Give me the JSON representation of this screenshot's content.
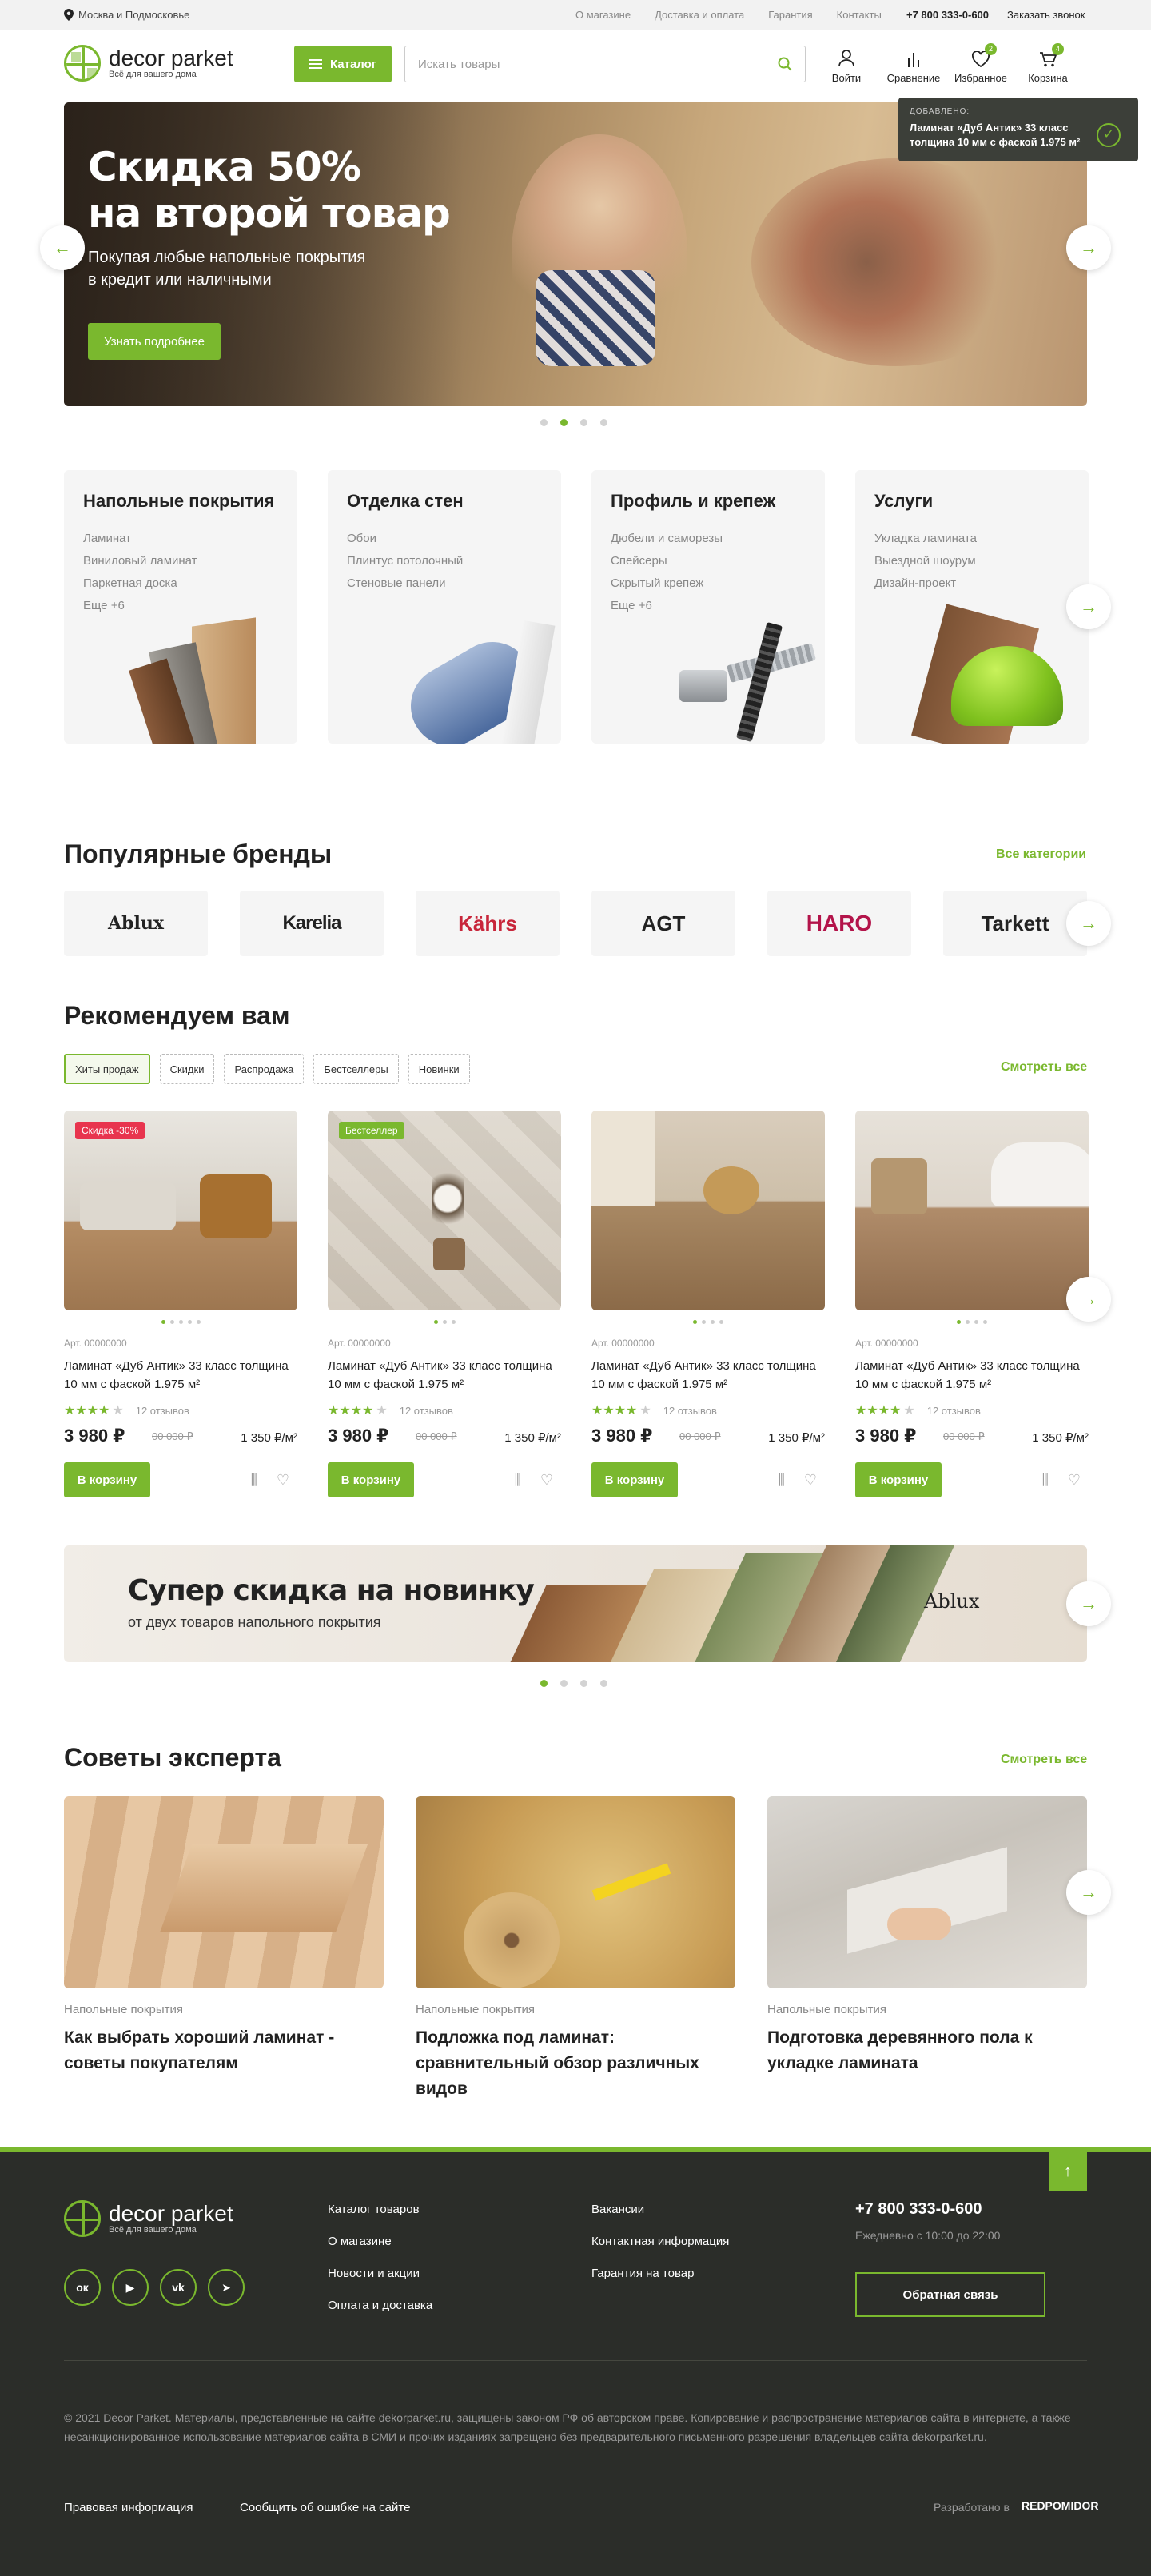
{
  "topbar": {
    "region": "Москва и Подмосковье",
    "links": [
      "О магазине",
      "Доставка и оплата",
      "Гарантия",
      "Контакты"
    ],
    "phone": "+7 800 333-0-600",
    "callback": "Заказать звонок"
  },
  "header": {
    "logo_name": "decor parket",
    "logo_sub": "Всё для вашего дома",
    "catalog": "Каталог",
    "search_placeholder": "Искать товары",
    "icons": [
      {
        "label": "Войти",
        "icon": "user-icon"
      },
      {
        "label": "Сравнение",
        "icon": "compare-icon"
      },
      {
        "label": "Избранное",
        "icon": "heart-icon",
        "badge": "2"
      },
      {
        "label": "Корзина",
        "icon": "cart-icon",
        "badge": "4"
      }
    ]
  },
  "toast": {
    "heading": "ДОБАВЛЕНО:",
    "text": "Ламинат «Дуб Антик» 33 класс толщина 10 мм с фаской 1.975 м²"
  },
  "hero": {
    "title_line1": "Скидка 50%",
    "title_line2": "на второй товар",
    "subtitle_line1": "Покупая любые напольные покрытия",
    "subtitle_line2": "в кредит или наличными",
    "button": "Узнать подробнее",
    "active_slide": 2,
    "slides": 4
  },
  "categories": [
    {
      "title": "Напольные покрытия",
      "items": [
        "Ламинат",
        "Виниловый ламинат",
        "Паркетная доска",
        "Еще +6"
      ]
    },
    {
      "title": "Отделка стен",
      "items": [
        "Обои",
        "Плинтус потолочный",
        "Стеновые панели"
      ]
    },
    {
      "title": "Профиль и крепеж",
      "items": [
        "Дюбели и саморезы",
        "Спейсеры",
        "Скрытый крепеж",
        "Еще +6"
      ]
    },
    {
      "title": "Услуги",
      "items": [
        "Укладка ламината",
        "Выездной шоурум",
        "Дизайн-проект"
      ]
    }
  ],
  "brands": {
    "title": "Популярные бренды",
    "all_link": "Все категории",
    "items": [
      {
        "name": "Ablux",
        "color": "#222222"
      },
      {
        "name": "Karelia",
        "color": "#111111"
      },
      {
        "name": "Kährs",
        "color": "#c8263b"
      },
      {
        "name": "AGT",
        "color": "#111111"
      },
      {
        "name": "HARO",
        "color": "#b3144a"
      },
      {
        "name": "Tarkett",
        "color": "#111111"
      }
    ]
  },
  "recommend": {
    "title": "Рекомендуем вам",
    "see_all": "Смотреть все",
    "filters": [
      "Хиты продаж",
      "Скидки",
      "Распродажа",
      "Бестселлеры",
      "Новинки"
    ],
    "products": [
      {
        "label": "Скидка -30%",
        "label_color": "#e8344e",
        "art": "Арт. 00000000",
        "name": "Ламинат «Дуб Антик» 33 класс толщина 10 мм с фаской 1.975 м²",
        "rating": 4,
        "reviews": "12 отзывов",
        "price": "3 980 ₽",
        "old_price": "00 000 ₽",
        "per_m2": "1 350 ₽/м²",
        "cart": "В корзину"
      },
      {
        "label": "Бестселлер",
        "label_color": "#7ab82e",
        "art": "Арт. 00000000",
        "name": "Ламинат «Дуб Антик» 33 класс толщина 10 мм с фаской 1.975 м²",
        "rating": 4,
        "reviews": "12 отзывов",
        "price": "3 980 ₽",
        "old_price": "00 000 ₽",
        "per_m2": "1 350 ₽/м²",
        "cart": "В корзину"
      },
      {
        "label": "",
        "label_color": "",
        "art": "Арт. 00000000",
        "name": "Ламинат «Дуб Антик» 33 класс толщина 10 мм с фаской 1.975 м²",
        "rating": 4,
        "reviews": "12 отзывов",
        "price": "3 980 ₽",
        "old_price": "00 000 ₽",
        "per_m2": "1 350 ₽/м²",
        "cart": "В корзину"
      },
      {
        "label": "",
        "label_color": "",
        "art": "Арт. 00000000",
        "name": "Ламинат «Дуб Антик» 33 класс толщина 10 мм с фаской 1.975 м²",
        "rating": 4,
        "reviews": "12 отзывов",
        "price": "3 980 ₽",
        "old_price": "00 000 ₽",
        "per_m2": "1 350 ₽/м²",
        "cart": "В корзину"
      }
    ]
  },
  "promo": {
    "title": "Супер скидка на новинку",
    "subtitle": "от двух товаров напольного покрытия",
    "brand": "Ablux"
  },
  "expert": {
    "title": "Советы эксперта",
    "see_all": "Смотреть все",
    "articles": [
      {
        "category": "Напольные покрытия",
        "title": "Как выбрать хороший ламинат - советы покупателям"
      },
      {
        "category": "Напольные покрытия",
        "title": "Подложка под ламинат: сравнительный обзор различных видов"
      },
      {
        "category": "Напольные покрытия",
        "title": "Подготовка деревянного пола к укладке ламината"
      }
    ]
  },
  "footer": {
    "logo_name": "decor parket",
    "logo_sub": "Всё для вашего дома",
    "col1": [
      "Каталог товаров",
      "О магазине",
      "Новости и акции",
      "Оплата и доставка"
    ],
    "col2": [
      "Вакансии",
      "Контактная информация",
      "Гарантия на товар"
    ],
    "phone": "+7 800 333-0-600",
    "hours": "Ежедневно с 10:00 до 22:00",
    "feedback": "Обратная связь",
    "social": [
      {
        "name": "odnoklassniki",
        "glyph": "ок"
      },
      {
        "name": "youtube",
        "glyph": "▶"
      },
      {
        "name": "vk",
        "glyph": "vk"
      },
      {
        "name": "telegram",
        "glyph": "➤"
      }
    ],
    "copyright": "© 2021 Decor Parket. Материалы, представленные на сайте dekorparket.ru, защищены законом РФ об авторском праве. Копирование и распространение материалов сайта в интернете, а также несанкционированное использование материалов сайта в СМИ и прочих изданиях запрещено без предварительного письменного разрешения владельцев сайта dekorparket.ru.",
    "legal": "Правовая информация",
    "report": "Сообщить об ошибке на сайте",
    "developed": "Разработано в",
    "dev_brand": "REDPOMIDOR"
  },
  "colors": {
    "accent": "#7ab82e",
    "footer_bg": "#2b2d29",
    "sale": "#e8344e"
  }
}
